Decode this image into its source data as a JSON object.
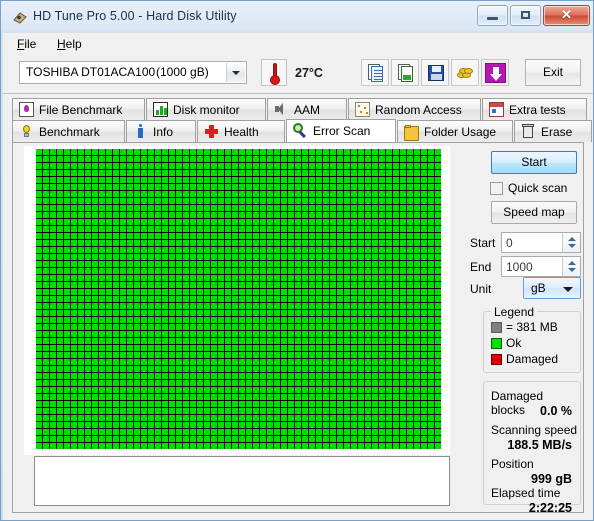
{
  "window": {
    "title": "HD Tune Pro 5.00 - Hard Disk Utility",
    "app_icon": "hdtune-icon",
    "minimize_label": "",
    "maximize_label": "",
    "close_label": "✕"
  },
  "menu": {
    "items": [
      {
        "label": "File",
        "mnemonic": "F"
      },
      {
        "label": "Help",
        "mnemonic": "H"
      }
    ]
  },
  "toolbar": {
    "drive": {
      "model": "TOSHIBA DT01ACA100",
      "capacity": "(1000 gB)"
    },
    "temperature": "27°C",
    "temperature_icon": "thermometer-icon",
    "buttons": [
      {
        "name": "copy-text-button",
        "icon": "copy-text-icon"
      },
      {
        "name": "copy-image-button",
        "icon": "copy-image-icon"
      },
      {
        "name": "save-button",
        "icon": "floppy-save-icon"
      },
      {
        "name": "register-button",
        "icon": "coins-icon"
      },
      {
        "name": "download-button",
        "icon": "download-arrow-icon"
      }
    ],
    "exit_label": "Exit"
  },
  "tabs": {
    "row1": [
      {
        "label": "File Benchmark",
        "icon": "file-benchmark-icon",
        "active": false
      },
      {
        "label": "Disk monitor",
        "icon": "disk-monitor-icon",
        "active": false
      },
      {
        "label": "AAM",
        "icon": "speaker-icon",
        "active": false
      },
      {
        "label": "Random Access",
        "icon": "random-access-icon",
        "active": false
      },
      {
        "label": "Extra tests",
        "icon": "extra-tests-icon",
        "active": false
      }
    ],
    "row2": [
      {
        "label": "Benchmark",
        "icon": "lightbulb-icon",
        "active": false
      },
      {
        "label": "Info",
        "icon": "info-icon",
        "active": false
      },
      {
        "label": "Health",
        "icon": "health-cross-icon",
        "active": false
      },
      {
        "label": "Error Scan",
        "icon": "magnifier-icon",
        "active": true
      },
      {
        "label": "Folder Usage",
        "icon": "folder-icon",
        "active": false
      },
      {
        "label": "Erase",
        "icon": "trash-icon",
        "active": false
      }
    ]
  },
  "scan": {
    "columns": 58,
    "rows": 43,
    "ok_color": "#00e000",
    "damaged_color": "#e00000",
    "background_color": "#000000",
    "all_ok": true
  },
  "controls": {
    "start_button": "Start",
    "quick_scan_label": "Quick scan",
    "quick_scan_checked": false,
    "speed_map_button": "Speed map",
    "start_label": "Start",
    "start_value": "0",
    "end_label": "End",
    "end_value": "1000",
    "unit_label": "Unit",
    "unit_value": "gB"
  },
  "legend": {
    "title": "Legend",
    "block_size": "= 381 MB",
    "ok_label": "Ok",
    "damaged_label": "Damaged"
  },
  "stats": {
    "damaged_blocks_label": "Damaged blocks",
    "damaged_blocks_value": "0.0 %",
    "scanning_speed_label": "Scanning speed",
    "scanning_speed_value": "188.5 MB/s",
    "position_label": "Position",
    "position_value": "999 gB",
    "elapsed_time_label": "Elapsed time",
    "elapsed_time_value": "2:22:25"
  },
  "log": {
    "text": ""
  }
}
